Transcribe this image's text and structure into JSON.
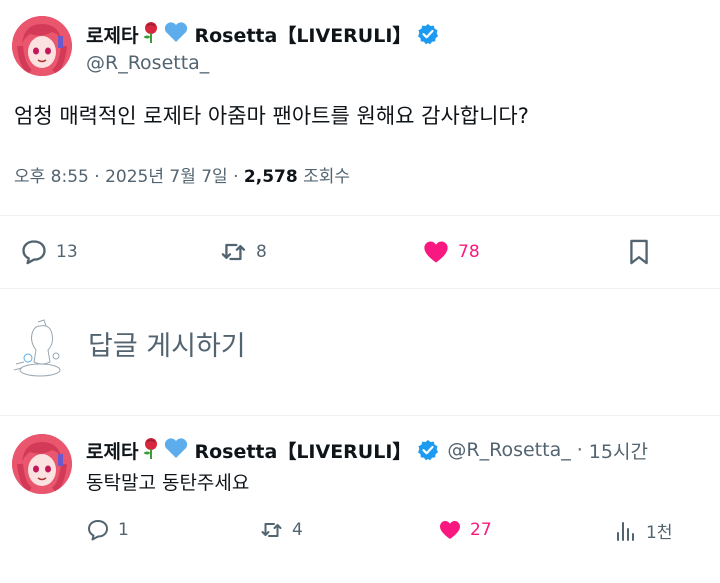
{
  "tweet": {
    "display_name": "로제타",
    "display_name_brand": "Rosetta【LIVERULI】",
    "name_emojis": [
      "rose-emoji",
      "blue-heart-emoji"
    ],
    "handle": "@R_Rosetta_",
    "text": "엄청 매력적인 로제타 아줌마 팬아트를 원해요 감사합니다?",
    "time": "오후 8:55",
    "date": "2025년 7월 7일",
    "views_count": "2,578",
    "views_label": "조회수",
    "replies": "13",
    "retweets": "8",
    "likes": "78"
  },
  "compose": {
    "placeholder": "답글 게시하기"
  },
  "reply": {
    "display_name": "로제타",
    "display_name_brand": "Rosetta【LIVERULI】",
    "handle": "@R_Rosetta_",
    "separator": "·",
    "time_ago": "15시간",
    "text": "동탁말고 동탄주세요",
    "replies": "1",
    "retweets": "4",
    "likes": "27",
    "views": "1천"
  },
  "colors": {
    "like_pink": "#f91880",
    "verified_blue": "#1d9bf0",
    "secondary_text": "#536471"
  }
}
